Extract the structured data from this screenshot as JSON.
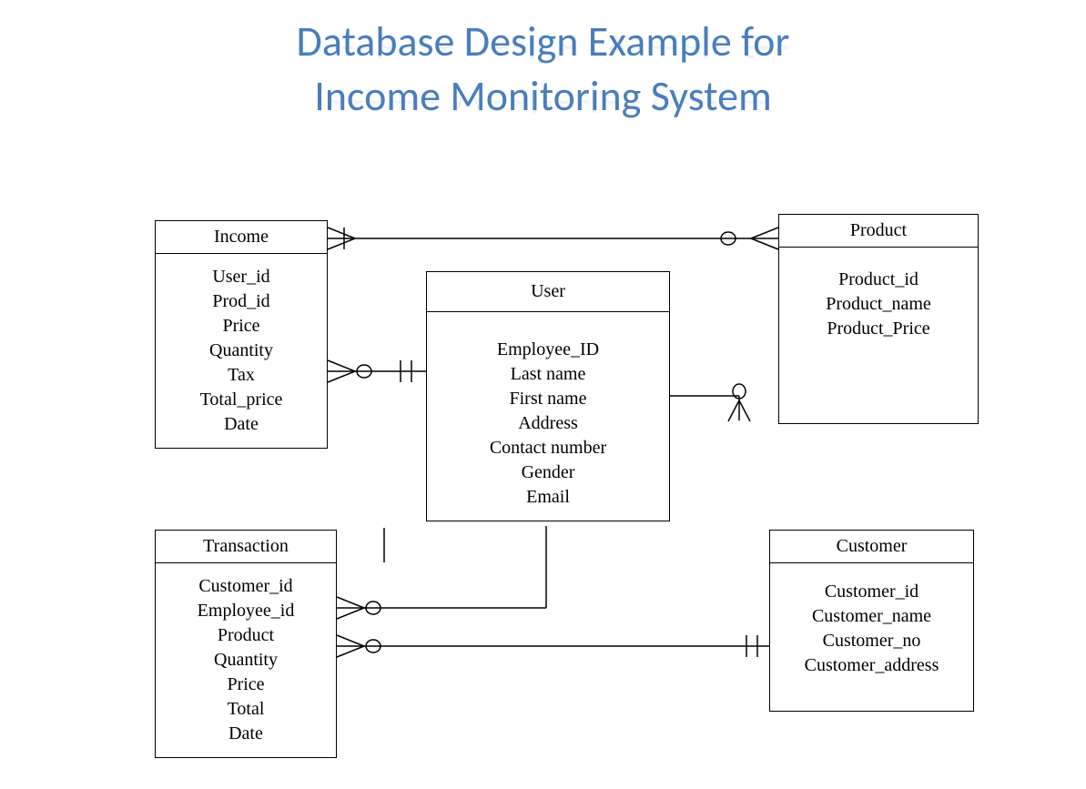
{
  "title_line1": "Database Design Example for",
  "title_line2": "Income Monitoring System",
  "entities": {
    "income": {
      "name": "Income",
      "attrs": [
        "User_id",
        "Prod_id",
        "Price",
        "Quantity",
        "Tax",
        "Total_price",
        "Date"
      ]
    },
    "product": {
      "name": "Product",
      "attrs": [
        "Product_id",
        "Product_name",
        "Product_Price"
      ]
    },
    "user": {
      "name": "User",
      "attrs": [
        "Employee_ID",
        "Last name",
        "First name",
        "Address",
        "Contact number",
        "Gender",
        "Email"
      ]
    },
    "transaction": {
      "name": "Transaction",
      "attrs": [
        "Customer_id",
        "Employee_id",
        "Product",
        "Quantity",
        "Price",
        "Total",
        "Date"
      ]
    },
    "customer": {
      "name": "Customer",
      "attrs": [
        "Customer_id",
        "Customer_name",
        "Customer_no",
        "Customer_address"
      ]
    }
  }
}
